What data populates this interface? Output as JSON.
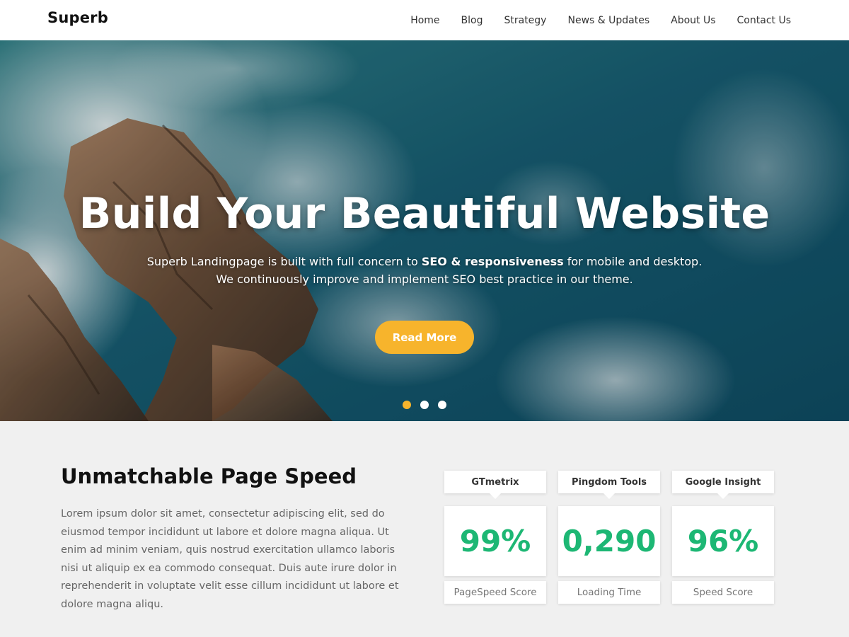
{
  "header": {
    "logo": "Superb",
    "nav": [
      "Home",
      "Blog",
      "Strategy",
      "News & Updates",
      "About Us",
      "Contact Us"
    ]
  },
  "hero": {
    "title": "Build Your Beautiful Website",
    "subtitle_line1_pre": "Superb Landingpage is built with full concern to ",
    "subtitle_line1_bold": "SEO & responsiveness",
    "subtitle_line1_post": " for mobile and desktop.",
    "subtitle_line2": "We continuously improve and implement SEO best practice in our theme.",
    "button": "Read More",
    "slides": 3,
    "active_slide": 1
  },
  "speed": {
    "title": "Unmatchable Page Speed",
    "text": "Lorem ipsum dolor sit amet, consectetur adipiscing elit, sed do eiusmod tempor incididunt ut labore et dolore magna aliqua. Ut enim ad minim veniam, quis nostrud exercitation ullamco laboris nisi ut aliquip ex ea commodo consequat. Duis aute irure dolor in reprehenderit in voluptate velit esse cillum incididunt ut labore et dolore magna aliqu."
  },
  "stats": [
    {
      "tool": "GTmetrix",
      "value": "99%",
      "label": "PageSpeed Score"
    },
    {
      "tool": "Pingdom Tools",
      "value": "0,290",
      "label": "Loading Time"
    },
    {
      "tool": "Google Insight",
      "value": "96%",
      "label": "Speed Score"
    }
  ],
  "colors": {
    "accent": "#f7b42c",
    "stat_value": "#1db774",
    "section_bg": "#f0f0f0"
  }
}
